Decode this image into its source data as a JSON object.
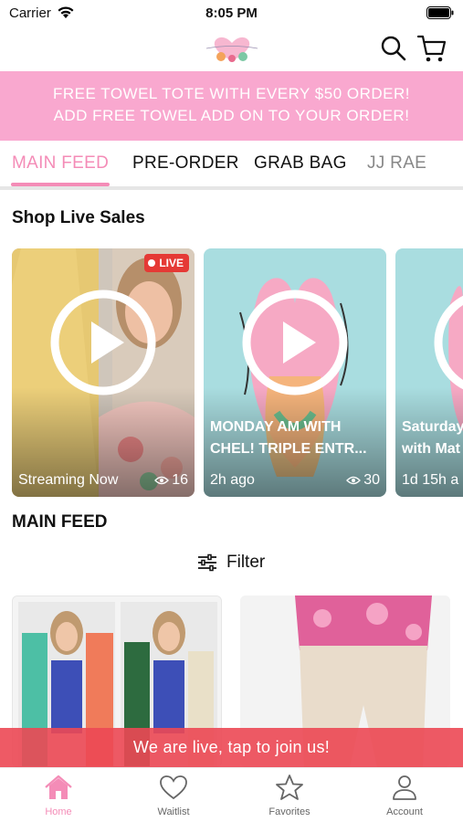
{
  "status": {
    "carrier": "Carrier",
    "time": "8:05 PM"
  },
  "header": {
    "logo_text": "jj rae"
  },
  "promo": {
    "line1": "FREE TOWEL TOTE WITH EVERY $50 ORDER!",
    "line2": "ADD FREE TOWEL ADD ON TO YOUR ORDER!"
  },
  "tabs": [
    {
      "label": "MAIN FEED",
      "active": true
    },
    {
      "label": "PRE-ORDER",
      "active": false
    },
    {
      "label": "GRAB BAG",
      "active": false
    },
    {
      "label": "JJ RAE",
      "active": false
    }
  ],
  "live_sales": {
    "title": "Shop Live Sales",
    "cards": [
      {
        "badge": "LIVE",
        "caption": "",
        "meta_left": "Streaming Now",
        "views": "16"
      },
      {
        "badge": "",
        "caption_line1": "MONDAY AM WITH",
        "caption_line2": "CHEL! TRIPLE ENTR...",
        "meta_left": "2h ago",
        "views": "30"
      },
      {
        "badge": "",
        "caption_line1": "Saturday",
        "caption_line2": "with Mat",
        "meta_left": "1d 15h a",
        "views": ""
      }
    ]
  },
  "main_feed": {
    "title": "MAIN FEED",
    "filter_label": "Filter"
  },
  "live_strip": "We are live, tap to join us!",
  "tabbar": [
    {
      "label": "Home",
      "icon": "home-icon",
      "active": true
    },
    {
      "label": "Waitlist",
      "icon": "heart-icon",
      "active": false
    },
    {
      "label": "Favorites",
      "icon": "star-icon",
      "active": false
    },
    {
      "label": "Account",
      "icon": "person-icon",
      "active": false
    }
  ],
  "colors": {
    "pink": "#f48cb7",
    "banner": "#f9a8cf",
    "live_red": "#e53935"
  }
}
